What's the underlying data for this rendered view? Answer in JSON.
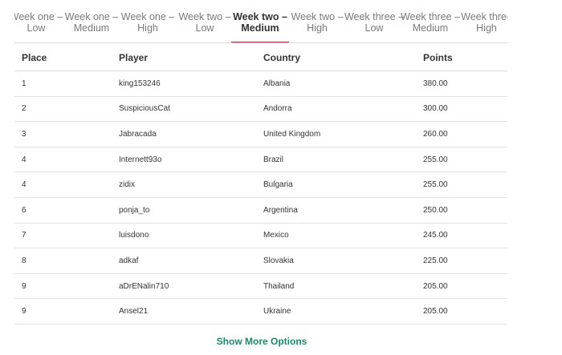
{
  "tabs": [
    {
      "line1": "Week one –",
      "line2": "Low",
      "active": false
    },
    {
      "line1": "Week one –",
      "line2": "Medium",
      "active": false
    },
    {
      "line1": "Week one –",
      "line2": "High",
      "active": false
    },
    {
      "line1": "Week two –",
      "line2": "Low",
      "active": false
    },
    {
      "line1": "Week two –",
      "line2": "Medium",
      "active": true
    },
    {
      "line1": "Week two –",
      "line2": "High",
      "active": false
    },
    {
      "line1": "Week three –",
      "line2": "Low",
      "active": false
    },
    {
      "line1": "Week three –",
      "line2": "Medium",
      "active": false
    },
    {
      "line1": "Week three",
      "line2": "High",
      "active": false
    }
  ],
  "table": {
    "headers": {
      "place": "Place",
      "player": "Player",
      "country": "Country",
      "points": "Points"
    },
    "rows": [
      {
        "place": "1",
        "player": "king153246",
        "country": "Albania",
        "points": "380.00"
      },
      {
        "place": "2",
        "player": "SuspiciousCat",
        "country": "Andorra",
        "points": "300.00"
      },
      {
        "place": "3",
        "player": "Jabracada",
        "country": "United Kingdom",
        "points": "260.00"
      },
      {
        "place": "4",
        "player": "Internett93o",
        "country": "Brazil",
        "points": "255.00"
      },
      {
        "place": "4",
        "player": "zidix",
        "country": "Bulgaria",
        "points": "255.00"
      },
      {
        "place": "6",
        "player": "ponja_to",
        "country": "Argentina",
        "points": "250.00"
      },
      {
        "place": "7",
        "player": "luisdono",
        "country": "Mexico",
        "points": "245.00"
      },
      {
        "place": "8",
        "player": "adkaf",
        "country": "Slovakia",
        "points": "225.00"
      },
      {
        "place": "9",
        "player": "aDrENalin710",
        "country": "Thailand",
        "points": "205.00"
      },
      {
        "place": "9",
        "player": "Ansel21",
        "country": "Ukraine",
        "points": "205.00"
      }
    ]
  },
  "show_more_label": "Show More Options",
  "colors": {
    "accent_underline": "#c8102e",
    "link": "#1a8a6e"
  }
}
